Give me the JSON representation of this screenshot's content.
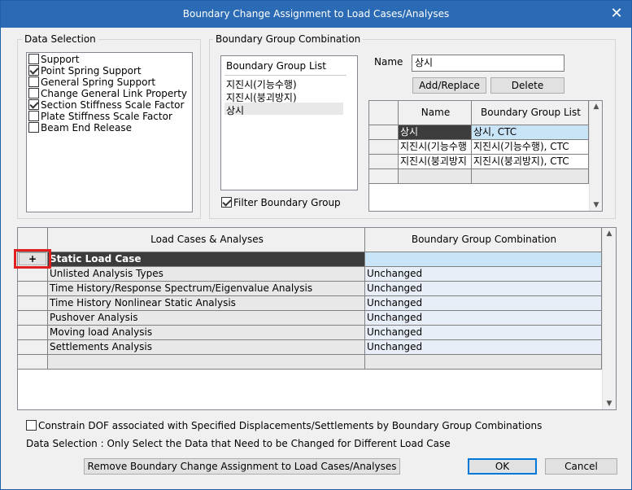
{
  "window": {
    "title": "Boundary Change Assignment to Load Cases/Analyses"
  },
  "data_selection": {
    "label": "Data Selection",
    "items": [
      {
        "label": "Support",
        "checked": false
      },
      {
        "label": "Point Spring Support",
        "checked": true
      },
      {
        "label": "General Spring Support",
        "checked": false
      },
      {
        "label": "Change General Link Property",
        "checked": false
      },
      {
        "label": "Section Stiffness Scale Factor",
        "checked": true
      },
      {
        "label": "Plate Stiffness Scale Factor",
        "checked": false
      },
      {
        "label": "Beam End Release",
        "checked": false
      }
    ]
  },
  "bgc": {
    "label": "Boundary Group Combination",
    "list_title": "Boundary Group List",
    "list_items": [
      "지진시(기능수행)",
      "지진시(붕괴방지)",
      "상시"
    ],
    "filter_label": "Filter Boundary Group",
    "filter_checked": true,
    "name_label": "Name",
    "name_value": "상시",
    "add_replace_label": "Add/Replace",
    "delete_label": "Delete",
    "table": {
      "headers": [
        "Name",
        "Boundary Group List"
      ],
      "rows": [
        [
          "상시",
          "상시, CTC"
        ],
        [
          "지진시(기능수행",
          "지진시(기능수행), CTC"
        ],
        [
          "지진시(붕괴방지",
          "지진시(붕괴방지), CTC"
        ]
      ]
    }
  },
  "main_table": {
    "headers": [
      "Load Cases & Analyses",
      "Boundary Group Combination"
    ],
    "expand_symbol": "+",
    "rows": [
      [
        "Static Load Case",
        ""
      ],
      [
        "Unlisted Analysis Types",
        "Unchanged"
      ],
      [
        "Time History/Response Spectrum/Eigenvalue Analysis",
        "Unchanged"
      ],
      [
        "Time History Nonlinear Static Analysis",
        "Unchanged"
      ],
      [
        "Pushover Analysis",
        "Unchanged"
      ],
      [
        "Moving load Analysis",
        "Unchanged"
      ],
      [
        "Settlements Analysis",
        "Unchanged"
      ]
    ]
  },
  "constrain_label": "Constrain DOF associated with Specified Displacements/Settlements by Boundary Group Combinations",
  "info_text": "Data Selection : Only Select the Data that Need to be Changed for Different Load Case",
  "remove_label": "Remove Boundary Change Assignment to Load Cases/Analyses",
  "ok_label": "OK",
  "cancel_label": "Cancel",
  "colors": {
    "title_bar": "#2b6bb5",
    "selected_cell": "#c9e4f6",
    "dark_row": "#3c3c3c",
    "highlight_box": "#e02020"
  }
}
